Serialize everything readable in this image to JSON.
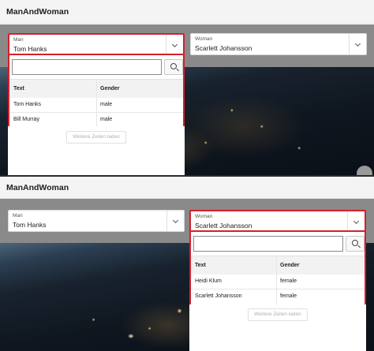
{
  "top": {
    "title": "ManAndWoman",
    "man": {
      "label": "Man",
      "value": "Tom Hanks"
    },
    "woman": {
      "label": "Woman",
      "value": "Scarlett Johansson"
    },
    "popup": {
      "search_value": "",
      "columns": [
        "Text",
        "Gender"
      ],
      "rows": [
        {
          "text": "Tom Hanks",
          "gender": "male"
        },
        {
          "text": "Bill Murray",
          "gender": "male"
        }
      ],
      "load_more": "Weitere Zeilen laden"
    }
  },
  "bottom": {
    "title": "ManAndWoman",
    "man": {
      "label": "Man",
      "value": "Tom Hanks"
    },
    "woman": {
      "label": "Woman",
      "value": "Scarlett Johansson"
    },
    "popup": {
      "search_value": "",
      "columns": [
        "Text",
        "Gender"
      ],
      "rows": [
        {
          "text": "Heidi Klum",
          "gender": "female"
        },
        {
          "text": "Scarlett Johansson",
          "gender": "female"
        }
      ],
      "load_more": "Weitere Zeilen laden"
    }
  },
  "colors": {
    "active_border": "#d4202a",
    "header_bg": "#f4f4f4"
  },
  "icons": {
    "dropdown": "chevron-down-icon",
    "search": "search-icon"
  }
}
